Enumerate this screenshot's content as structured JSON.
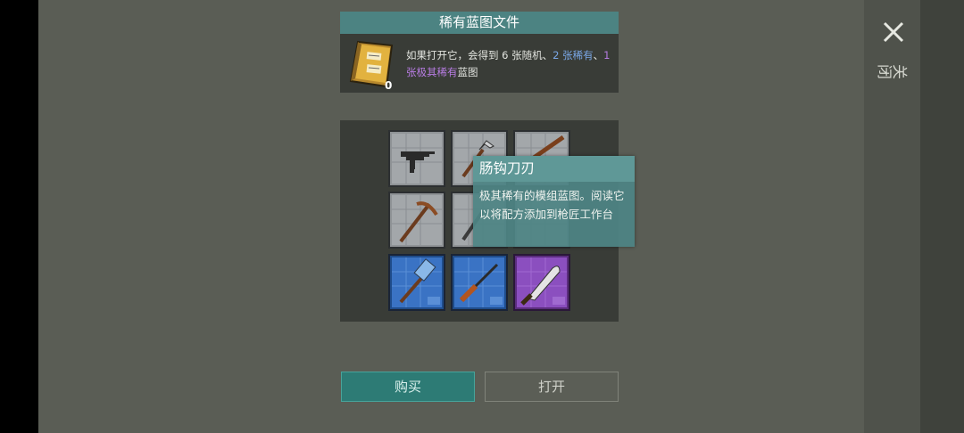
{
  "panel": {
    "close_icon": "close-x-icon",
    "close_label": "关闭"
  },
  "info": {
    "title": "稀有蓝图文件",
    "book_icon": "blueprint-folder-icon",
    "count": "0",
    "desc_part1": "如果打开它，会得到 6 张随机、",
    "desc_part2": "2 张稀有",
    "desc_part3": "、",
    "desc_part4": "1 张极其稀有",
    "desc_part5": "蓝图",
    "colors": {
      "rare": "#7aa7e6",
      "epic": "#b77ce2"
    }
  },
  "grid": {
    "items": [
      {
        "name": "uzi",
        "rarity": "common"
      },
      {
        "name": "hook-blade",
        "rarity": "common"
      },
      {
        "name": "wooden-stick",
        "rarity": "common"
      },
      {
        "name": "pickaxe",
        "rarity": "common"
      },
      {
        "name": "crowbar",
        "rarity": "common"
      },
      {
        "name": "unknown",
        "rarity": "common"
      },
      {
        "name": "sledgehammer",
        "rarity": "rare"
      },
      {
        "name": "hunting-rifle",
        "rarity": "rare"
      },
      {
        "name": "machete",
        "rarity": "epic"
      }
    ]
  },
  "tooltip": {
    "title": "肠钩刀刃",
    "body": "极其稀有的模组蓝图。阅读它以将配方添加到枪匠工作台"
  },
  "buttons": {
    "buy": "购买",
    "open": "打开"
  }
}
